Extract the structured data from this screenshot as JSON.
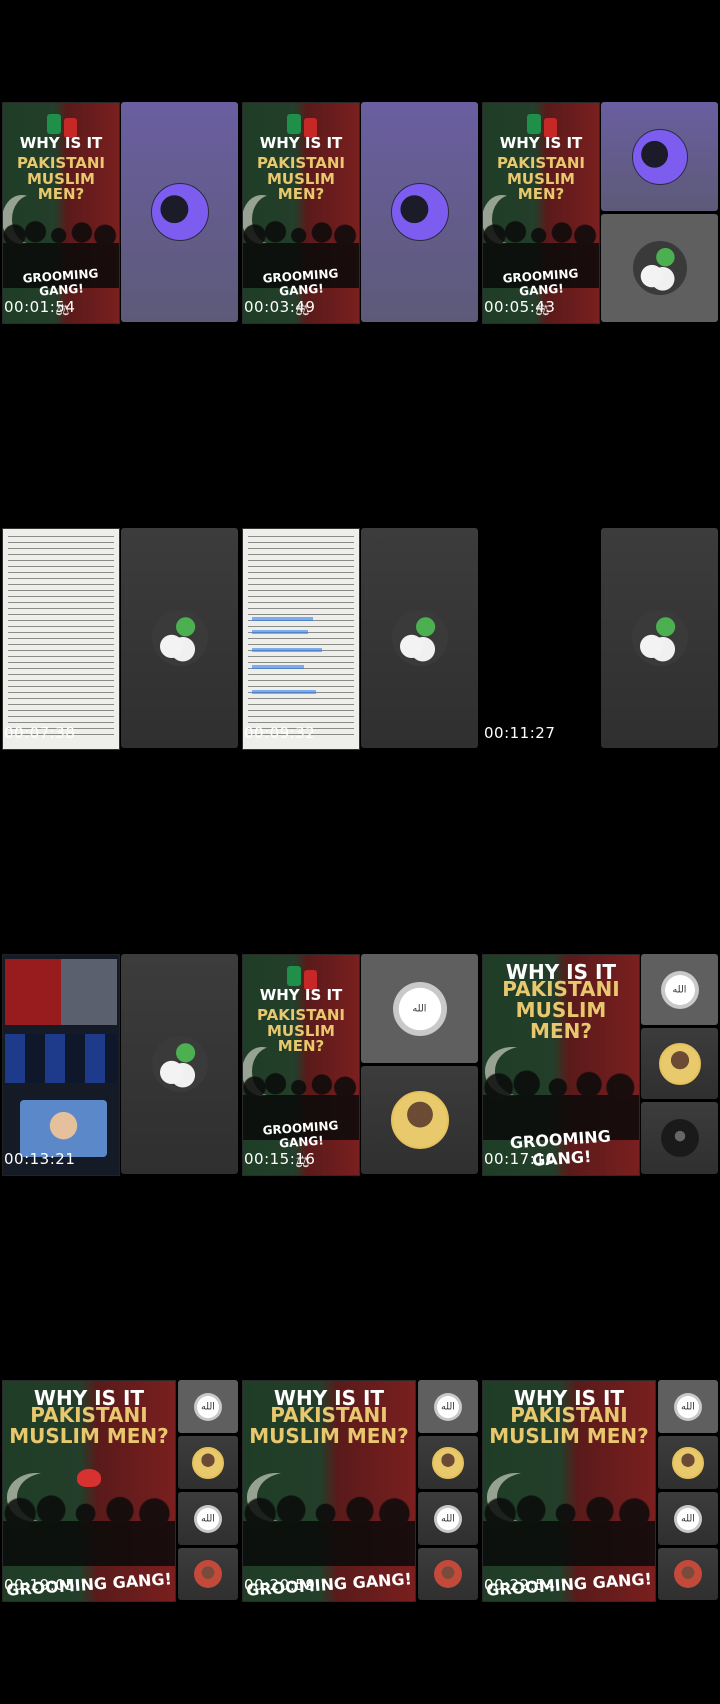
{
  "contact_sheet": {
    "frames": [
      {
        "timestamp": "00:01:54",
        "layout": "poster-purple"
      },
      {
        "timestamp": "00:03:49",
        "layout": "poster-purple"
      },
      {
        "timestamp": "00:05:43",
        "layout": "poster-two"
      },
      {
        "timestamp": "00:07:38",
        "layout": "doc-green"
      },
      {
        "timestamp": "00:09:32",
        "layout": "doc-green-hl"
      },
      {
        "timestamp": "00:11:27",
        "layout": "green-only"
      },
      {
        "timestamp": "00:13:21",
        "layout": "news-green"
      },
      {
        "timestamp": "00:15:16",
        "layout": "poster-allah-person"
      },
      {
        "timestamp": "00:17:10",
        "layout": "poster-big-three"
      },
      {
        "timestamp": "00:19:05",
        "layout": "poster-big-four-heart"
      },
      {
        "timestamp": "00:20:59",
        "layout": "poster-big-four"
      },
      {
        "timestamp": "00:22:54",
        "layout": "poster-big-four"
      }
    ]
  },
  "poster": {
    "line1": "WHY IS IT",
    "line2": "PAKISTANI",
    "line3": "MUSLIM MEN?",
    "tagline": "GROOMING GANG!"
  },
  "colors": {
    "background": "#000000",
    "timestamp_text": "#ffffff",
    "poster_title_white": "#ffffff",
    "poster_title_gold": "#e7c86e",
    "flag_green": "#1f3d26",
    "flag_red": "#7a1f1f",
    "tile_purple": "#6a5ea0",
    "tile_gray": "#3c3c3c"
  },
  "icons": [
    "participant-icons",
    "scales-of-justice-icon",
    "crescent-moon-icon"
  ]
}
